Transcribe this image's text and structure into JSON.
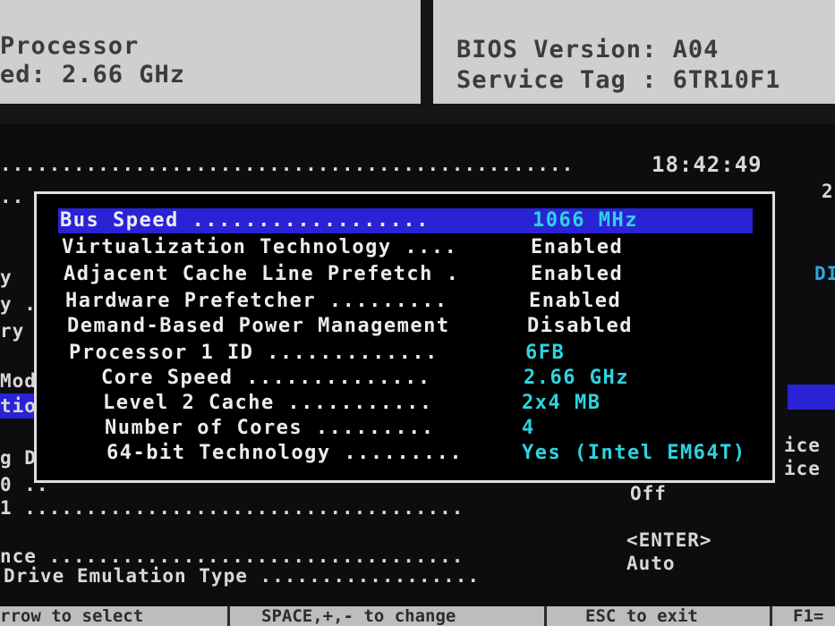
{
  "header": {
    "processor_label": "Processor",
    "speed_line": "ed: 2.66 GHz",
    "bios_line": "BIOS Version: A04",
    "service_tag_line": "Service Tag : 6TR10F1"
  },
  "screen": {
    "clock": "18:42:49",
    "right_digit": "2",
    "right_fragment": "DI",
    "left_fragments": [
      "y",
      "y .",
      "ry",
      "Mod",
      "tio",
      "g Dr",
      "0 ..",
      "1"
    ],
    "right_ice_1": "ice",
    "right_ice_2": "ice",
    "rows": [
      {
        "dots": "1 ....................................",
        "value": "Off"
      },
      {
        "dots": "nce ..................................",
        "value": "<ENTER>"
      },
      {
        "dots": "Drive Emulation Type ..................",
        "value": "Auto"
      }
    ]
  },
  "popup": {
    "items": [
      {
        "label": "Bus Speed ..................",
        "value": "1066 MHz",
        "selected": true
      },
      {
        "label": "Virtualization Technology ....",
        "value": "Enabled"
      },
      {
        "label": "Adjacent Cache Line Prefetch .",
        "value": "Enabled"
      },
      {
        "label": "Hardware Prefetcher .........",
        "value": "Enabled"
      },
      {
        "label": "Demand-Based Power Management",
        "value": "Disabled"
      },
      {
        "label": "Processor 1 ID .............",
        "value": "6FB"
      },
      {
        "label": "Core Speed ..............",
        "value": "2.66 GHz"
      },
      {
        "label": "Level 2 Cache ...........",
        "value": "2x4 MB"
      },
      {
        "label": "Number of Cores .........",
        "value": "4"
      },
      {
        "label": "64-bit Technology .........",
        "value": "Yes (Intel EM64T)"
      }
    ]
  },
  "footer": {
    "select_hint": "rrow to select",
    "change_hint": "SPACE,+,- to change",
    "exit_hint": "ESC to exit",
    "help_hint": "F1="
  },
  "colors": {
    "selection": "#2a23d6",
    "value_cyan": "#2fd3e0",
    "header_bg": "#cfcfcd"
  }
}
